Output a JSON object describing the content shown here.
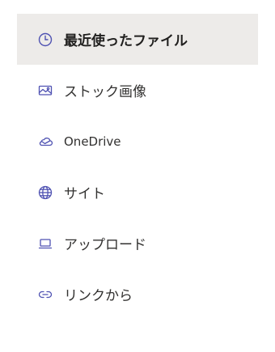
{
  "nav": {
    "accent_color": "#4f52b2",
    "selected_background": "#edebe9",
    "items": [
      {
        "label": "最近使ったファイル",
        "icon": "clock-icon",
        "selected": true
      },
      {
        "label": "ストック画像",
        "icon": "image-icon",
        "selected": false
      },
      {
        "label": "OneDrive",
        "icon": "cloud-icon",
        "selected": false
      },
      {
        "label": "サイト",
        "icon": "globe-icon",
        "selected": false
      },
      {
        "label": "アップロード",
        "icon": "laptop-icon",
        "selected": false
      },
      {
        "label": "リンクから",
        "icon": "link-icon",
        "selected": false
      }
    ]
  }
}
